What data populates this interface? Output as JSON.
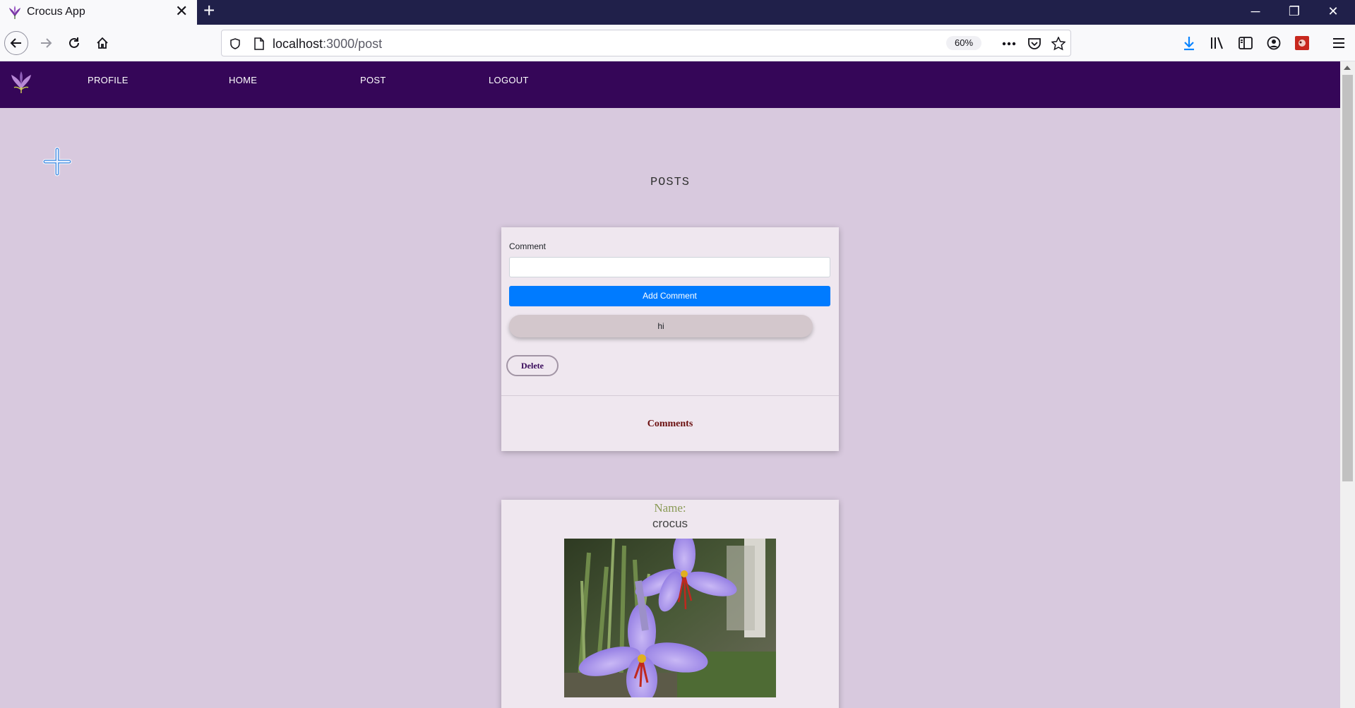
{
  "browser": {
    "tab_title": "Crocus App",
    "url_host": "localhost",
    "url_path": ":3000/post",
    "zoom": "60%"
  },
  "nav": {
    "links": [
      "PROFILE",
      "HOME",
      "POST",
      "LOGOUT"
    ]
  },
  "page": {
    "title": "POSTS"
  },
  "comment_card": {
    "label": "Comment",
    "input_value": "",
    "add_button": "Add Comment",
    "comments": [
      "hi"
    ],
    "delete_button": "Delete",
    "comments_heading": "Comments"
  },
  "post_card": {
    "name_label": "Name:",
    "name_value": "crocus",
    "image": "crocus-flower-photo"
  },
  "colors": {
    "page_bg": "#d8c9de",
    "nav_bg": "#350658",
    "primary_button": "#007bff",
    "card_bg": "#efe7ef"
  }
}
